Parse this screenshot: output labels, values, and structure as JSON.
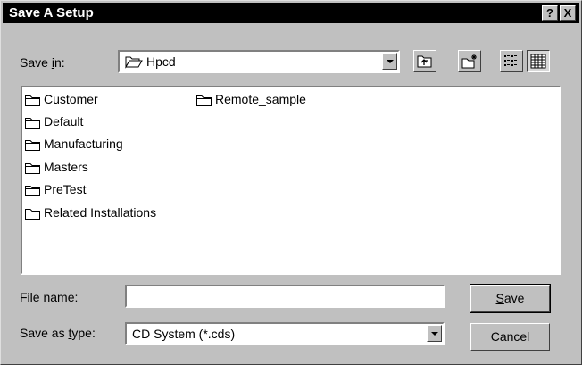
{
  "dialog": {
    "title": "Save A Setup",
    "help_label": "?",
    "close_label": "X"
  },
  "save_in": {
    "label_pre": "Save ",
    "label_hot": "i",
    "label_post": "n:",
    "value": "Hpcd"
  },
  "toolbar": {
    "icons": [
      "up-one-level-icon",
      "create-new-folder-icon",
      "list-view-icon",
      "details-view-icon"
    ]
  },
  "files": [
    {
      "name": "Customer"
    },
    {
      "name": "Default"
    },
    {
      "name": "Manufacturing"
    },
    {
      "name": "Masters"
    },
    {
      "name": "PreTest"
    },
    {
      "name": "Related Installations"
    },
    {
      "name": "Remote_sample"
    }
  ],
  "file_name": {
    "label_pre": "File ",
    "label_hot": "n",
    "label_post": "ame:",
    "value": ""
  },
  "save_as_type": {
    "label_pre": "Save as ",
    "label_hot": "t",
    "label_post": "ype:",
    "value": "CD System (*.cds)"
  },
  "buttons": {
    "save_hot": "S",
    "save_rest": "ave",
    "cancel": "Cancel"
  },
  "colors": {
    "face": "#c0c0c0",
    "titlebar": "#000000",
    "window": "#ffffff"
  }
}
